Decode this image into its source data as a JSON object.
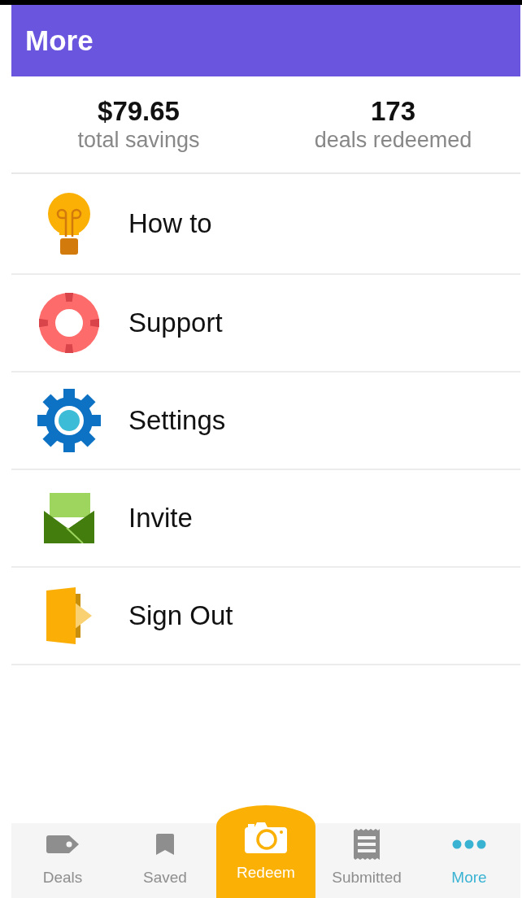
{
  "header": {
    "title": "More"
  },
  "stats": [
    {
      "value": "$79.65",
      "label": "total savings"
    },
    {
      "value": "173",
      "label": "deals redeemed"
    }
  ],
  "menu": [
    {
      "label": "How to"
    },
    {
      "label": "Support"
    },
    {
      "label": "Settings"
    },
    {
      "label": "Invite"
    },
    {
      "label": "Sign Out"
    }
  ],
  "tab_bar": [
    {
      "label": "Deals",
      "kind": "tab",
      "selected": false
    },
    {
      "label": "Saved",
      "kind": "tab",
      "selected": false
    },
    {
      "label": "Redeem",
      "kind": "action"
    },
    {
      "label": "Submitted",
      "kind": "tab",
      "selected": false
    },
    {
      "label": "More",
      "kind": "tab",
      "selected": true
    }
  ]
}
